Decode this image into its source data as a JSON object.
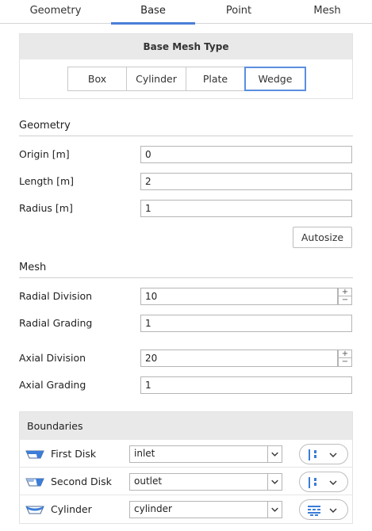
{
  "tabs": [
    {
      "label": "Geometry",
      "active": false
    },
    {
      "label": "Base",
      "active": true
    },
    {
      "label": "Point",
      "active": false
    },
    {
      "label": "Mesh",
      "active": false
    }
  ],
  "base_mesh_type": {
    "title": "Base Mesh Type",
    "options": [
      "Box",
      "Cylinder",
      "Plate",
      "Wedge"
    ],
    "selected": "Wedge"
  },
  "geometry": {
    "title": "Geometry",
    "origin": {
      "label": "Origin [m]",
      "value": "0"
    },
    "length": {
      "label": "Length [m]",
      "value": "2"
    },
    "radius": {
      "label": "Radius [m]",
      "value": "1"
    },
    "autosize_label": "Autosize"
  },
  "mesh": {
    "title": "Mesh",
    "radial_division": {
      "label": "Radial Division",
      "value": "10"
    },
    "radial_grading": {
      "label": "Radial Grading",
      "value": "1"
    },
    "axial_division": {
      "label": "Axial Division",
      "value": "20"
    },
    "axial_grading": {
      "label": "Axial Grading",
      "value": "1"
    }
  },
  "boundaries": {
    "title": "Boundaries",
    "rows": [
      {
        "name": "First Disk",
        "value": "inlet",
        "icon": "first-disk-icon",
        "type_icon": "patch-type-icon"
      },
      {
        "name": "Second Disk",
        "value": "outlet",
        "icon": "second-disk-icon",
        "type_icon": "patch-type-icon"
      },
      {
        "name": "Cylinder",
        "value": "cylinder",
        "icon": "cylinder-surface-icon",
        "type_icon": "wall-type-icon"
      }
    ]
  },
  "colors": {
    "accent": "#4a7fd8",
    "icon_blue": "#3b7dd8",
    "header_bg": "#e9e9e9"
  }
}
